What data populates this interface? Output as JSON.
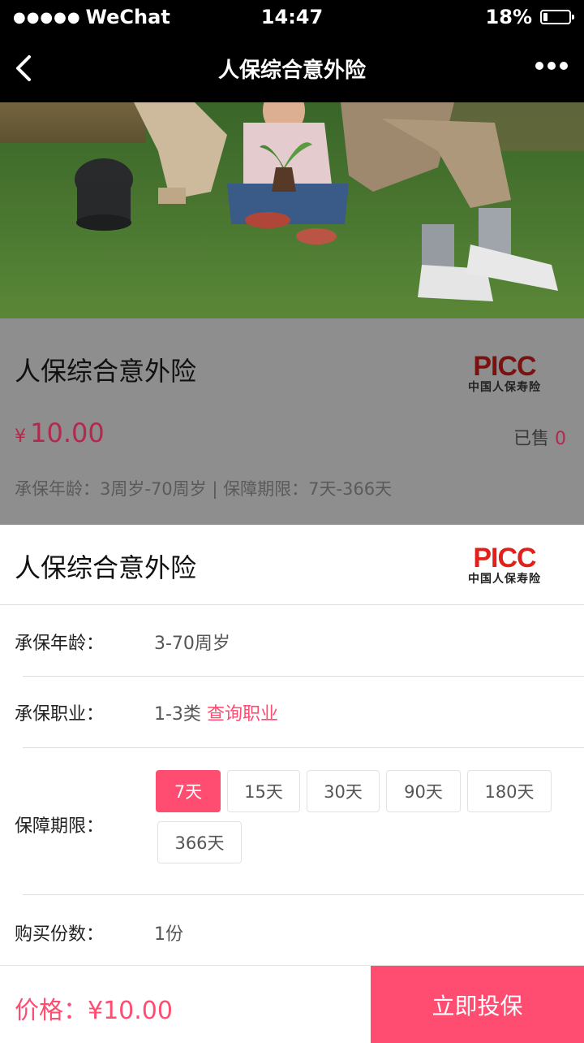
{
  "status_bar": {
    "carrier": "WeChat",
    "time": "14:47",
    "battery_text": "18%",
    "battery_level": 0.18
  },
  "nav": {
    "title": "人保综合意外险"
  },
  "product": {
    "name": "人保综合意外险",
    "price_currency": "¥",
    "price_amount": "10.00",
    "sold_label": "已售",
    "sold_count": "0",
    "terms": "承保年龄：3周岁-70周岁 | 保障期限：7天-366天",
    "logo_mark": "PICC",
    "logo_cn": "中国人保寿险"
  },
  "sheet": {
    "title": "人保综合意外险",
    "logo_mark": "PICC",
    "logo_cn": "中国人保寿险",
    "age_label": "承保年龄：",
    "age_value": "3-70周岁",
    "job_label": "承保职业：",
    "job_value": "1-3类",
    "job_link": "查询职业",
    "duration_label": "保障期限：",
    "durations": [
      "7天",
      "15天",
      "30天",
      "90天",
      "180天",
      "366天"
    ],
    "selected_duration": "7天",
    "qty_label": "购买份数：",
    "qty_value": "1份"
  },
  "footer": {
    "price_text": "价格：¥10.00",
    "buy_label": "立即投保"
  },
  "colors": {
    "accent": "#ff4c71",
    "nav_bg": "#000000",
    "overlay": "#8e8e8e",
    "picc_red": "#e0201b"
  }
}
